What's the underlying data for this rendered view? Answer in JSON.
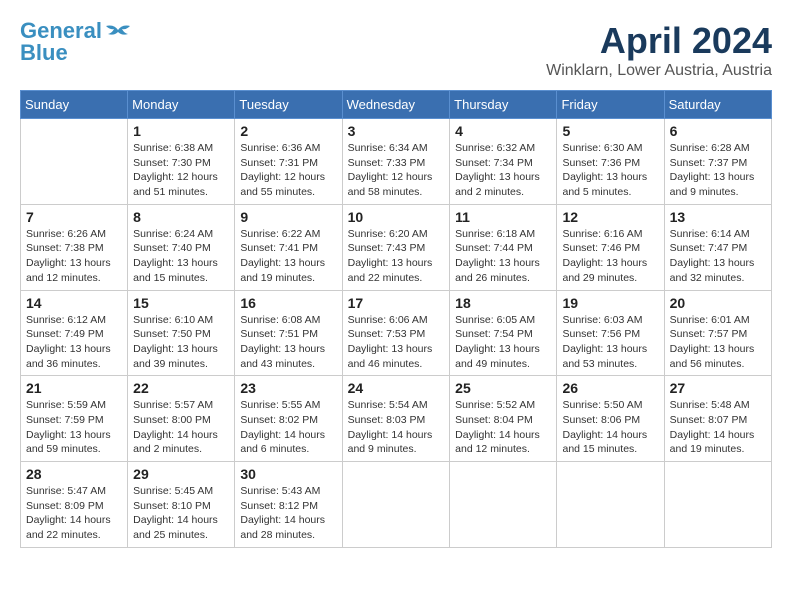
{
  "header": {
    "logo": {
      "line1": "General",
      "line2": "Blue"
    },
    "month_title": "April 2024",
    "subtitle": "Winklarn, Lower Austria, Austria"
  },
  "calendar": {
    "days_of_week": [
      "Sunday",
      "Monday",
      "Tuesday",
      "Wednesday",
      "Thursday",
      "Friday",
      "Saturday"
    ],
    "weeks": [
      [
        {
          "day": "",
          "info": ""
        },
        {
          "day": "1",
          "info": "Sunrise: 6:38 AM\nSunset: 7:30 PM\nDaylight: 12 hours\nand 51 minutes."
        },
        {
          "day": "2",
          "info": "Sunrise: 6:36 AM\nSunset: 7:31 PM\nDaylight: 12 hours\nand 55 minutes."
        },
        {
          "day": "3",
          "info": "Sunrise: 6:34 AM\nSunset: 7:33 PM\nDaylight: 12 hours\nand 58 minutes."
        },
        {
          "day": "4",
          "info": "Sunrise: 6:32 AM\nSunset: 7:34 PM\nDaylight: 13 hours\nand 2 minutes."
        },
        {
          "day": "5",
          "info": "Sunrise: 6:30 AM\nSunset: 7:36 PM\nDaylight: 13 hours\nand 5 minutes."
        },
        {
          "day": "6",
          "info": "Sunrise: 6:28 AM\nSunset: 7:37 PM\nDaylight: 13 hours\nand 9 minutes."
        }
      ],
      [
        {
          "day": "7",
          "info": "Sunrise: 6:26 AM\nSunset: 7:38 PM\nDaylight: 13 hours\nand 12 minutes."
        },
        {
          "day": "8",
          "info": "Sunrise: 6:24 AM\nSunset: 7:40 PM\nDaylight: 13 hours\nand 15 minutes."
        },
        {
          "day": "9",
          "info": "Sunrise: 6:22 AM\nSunset: 7:41 PM\nDaylight: 13 hours\nand 19 minutes."
        },
        {
          "day": "10",
          "info": "Sunrise: 6:20 AM\nSunset: 7:43 PM\nDaylight: 13 hours\nand 22 minutes."
        },
        {
          "day": "11",
          "info": "Sunrise: 6:18 AM\nSunset: 7:44 PM\nDaylight: 13 hours\nand 26 minutes."
        },
        {
          "day": "12",
          "info": "Sunrise: 6:16 AM\nSunset: 7:46 PM\nDaylight: 13 hours\nand 29 minutes."
        },
        {
          "day": "13",
          "info": "Sunrise: 6:14 AM\nSunset: 7:47 PM\nDaylight: 13 hours\nand 32 minutes."
        }
      ],
      [
        {
          "day": "14",
          "info": "Sunrise: 6:12 AM\nSunset: 7:49 PM\nDaylight: 13 hours\nand 36 minutes."
        },
        {
          "day": "15",
          "info": "Sunrise: 6:10 AM\nSunset: 7:50 PM\nDaylight: 13 hours\nand 39 minutes."
        },
        {
          "day": "16",
          "info": "Sunrise: 6:08 AM\nSunset: 7:51 PM\nDaylight: 13 hours\nand 43 minutes."
        },
        {
          "day": "17",
          "info": "Sunrise: 6:06 AM\nSunset: 7:53 PM\nDaylight: 13 hours\nand 46 minutes."
        },
        {
          "day": "18",
          "info": "Sunrise: 6:05 AM\nSunset: 7:54 PM\nDaylight: 13 hours\nand 49 minutes."
        },
        {
          "day": "19",
          "info": "Sunrise: 6:03 AM\nSunset: 7:56 PM\nDaylight: 13 hours\nand 53 minutes."
        },
        {
          "day": "20",
          "info": "Sunrise: 6:01 AM\nSunset: 7:57 PM\nDaylight: 13 hours\nand 56 minutes."
        }
      ],
      [
        {
          "day": "21",
          "info": "Sunrise: 5:59 AM\nSunset: 7:59 PM\nDaylight: 13 hours\nand 59 minutes."
        },
        {
          "day": "22",
          "info": "Sunrise: 5:57 AM\nSunset: 8:00 PM\nDaylight: 14 hours\nand 2 minutes."
        },
        {
          "day": "23",
          "info": "Sunrise: 5:55 AM\nSunset: 8:02 PM\nDaylight: 14 hours\nand 6 minutes."
        },
        {
          "day": "24",
          "info": "Sunrise: 5:54 AM\nSunset: 8:03 PM\nDaylight: 14 hours\nand 9 minutes."
        },
        {
          "day": "25",
          "info": "Sunrise: 5:52 AM\nSunset: 8:04 PM\nDaylight: 14 hours\nand 12 minutes."
        },
        {
          "day": "26",
          "info": "Sunrise: 5:50 AM\nSunset: 8:06 PM\nDaylight: 14 hours\nand 15 minutes."
        },
        {
          "day": "27",
          "info": "Sunrise: 5:48 AM\nSunset: 8:07 PM\nDaylight: 14 hours\nand 19 minutes."
        }
      ],
      [
        {
          "day": "28",
          "info": "Sunrise: 5:47 AM\nSunset: 8:09 PM\nDaylight: 14 hours\nand 22 minutes."
        },
        {
          "day": "29",
          "info": "Sunrise: 5:45 AM\nSunset: 8:10 PM\nDaylight: 14 hours\nand 25 minutes."
        },
        {
          "day": "30",
          "info": "Sunrise: 5:43 AM\nSunset: 8:12 PM\nDaylight: 14 hours\nand 28 minutes."
        },
        {
          "day": "",
          "info": ""
        },
        {
          "day": "",
          "info": ""
        },
        {
          "day": "",
          "info": ""
        },
        {
          "day": "",
          "info": ""
        }
      ]
    ]
  }
}
